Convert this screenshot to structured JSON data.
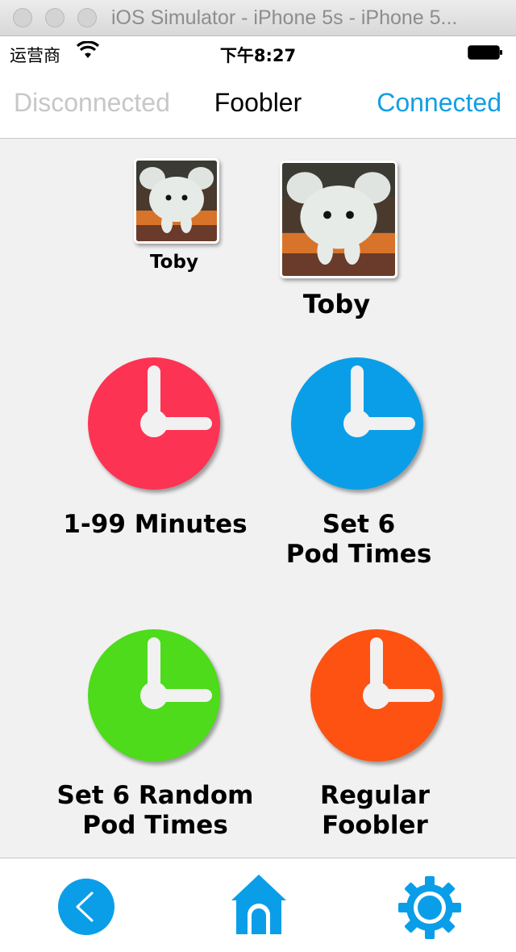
{
  "window": {
    "title": "iOS Simulator - iPhone 5s - iPhone 5..."
  },
  "status_bar": {
    "carrier": "运营商",
    "time": "下午8:27",
    "icons": [
      "wifi-icon",
      "battery-icon"
    ]
  },
  "nav": {
    "left": "Disconnected",
    "title": "Foobler",
    "right": "Connected"
  },
  "pets": [
    {
      "name": "Toby",
      "size": "small"
    },
    {
      "name": "Toby",
      "size": "large"
    }
  ],
  "options": [
    {
      "label": "1-99 Minutes",
      "color": "#fd3353"
    },
    {
      "label": "Set 6\nPod Times",
      "color": "#0b9ee8"
    },
    {
      "label": "Set 6 Random\nPod Times",
      "color": "#4ddb1b"
    },
    {
      "label": "Regular\nFoobler",
      "color": "#fd5211"
    }
  ],
  "tabbar": {
    "items": [
      "back-icon",
      "home-icon",
      "settings-gear-icon"
    ],
    "accent": "#0b9ee8"
  }
}
